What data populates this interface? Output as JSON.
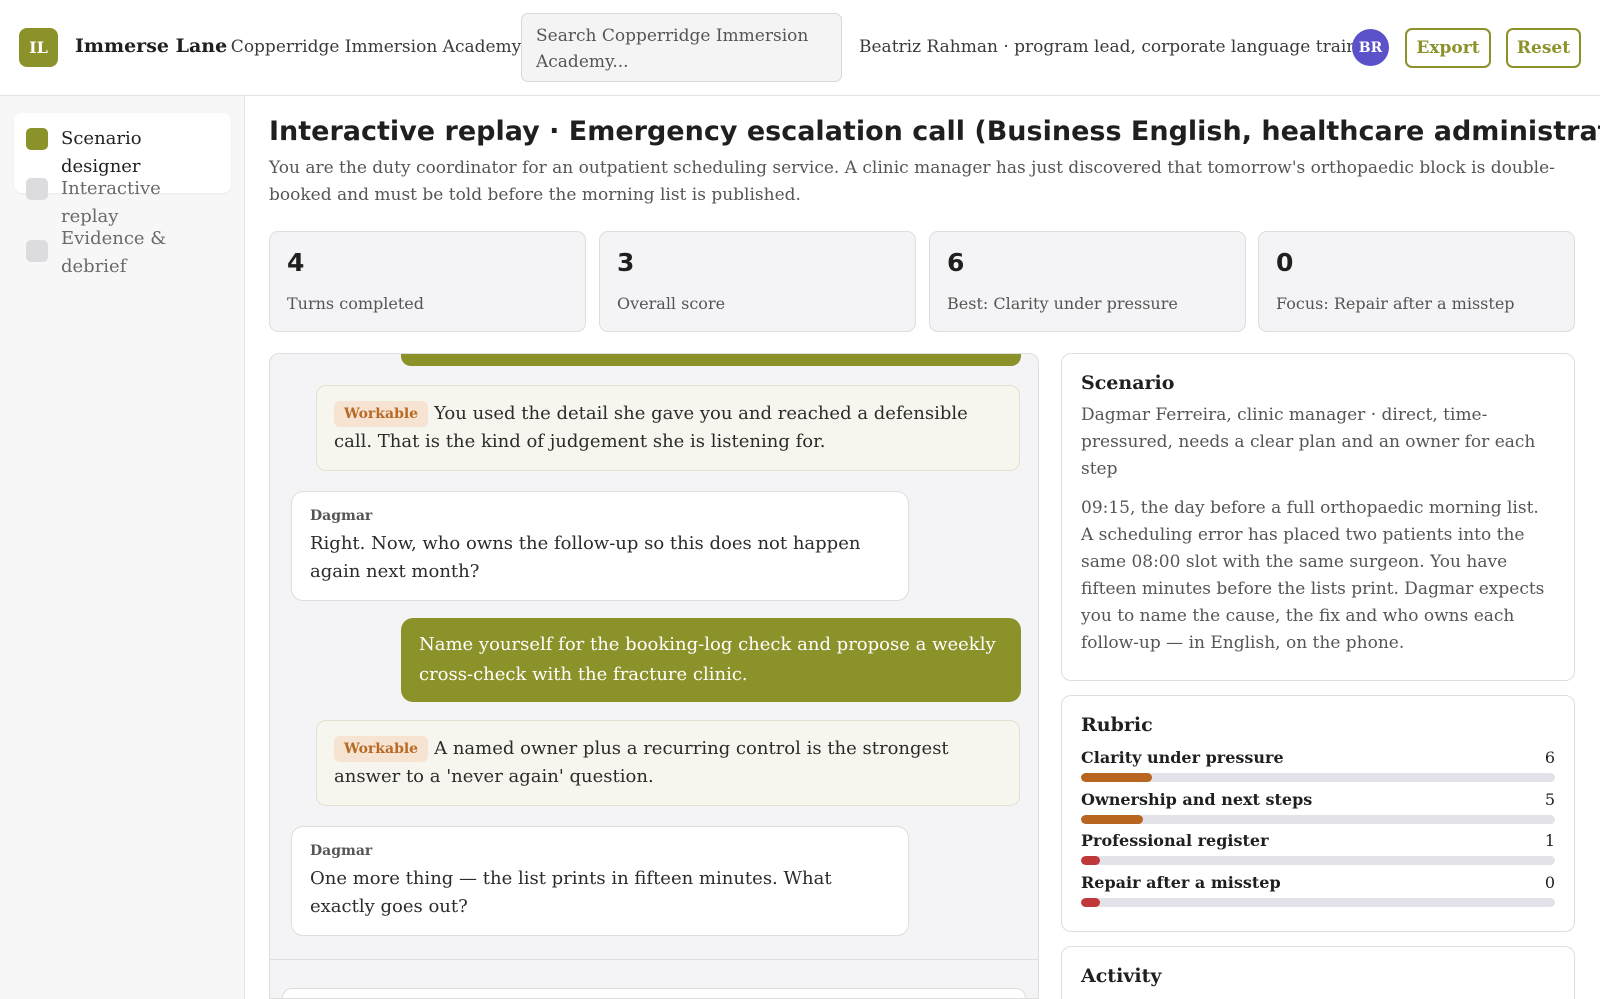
{
  "app": {
    "logo_initials": "IL",
    "name": "Immerse Lane",
    "org": "· Copperridge Immersion Academy",
    "search_placeholder": "Search Copperridge Immersion Academy...",
    "user": "Beatriz Rahman · program lead, corporate language training",
    "user_initials": "BR",
    "export_label": "Export",
    "reset_label": "Reset"
  },
  "sidebar": {
    "items": [
      {
        "label": "Scenario designer",
        "active": true
      },
      {
        "label": "Interactive replay",
        "active": false
      },
      {
        "label": "Evidence & debrief",
        "active": false
      }
    ]
  },
  "page": {
    "title": "Interactive replay · Emergency escalation call (Business English, healthcare administration)",
    "description": "You are the duty coordinator for an outpatient scheduling service. A clinic manager has just discovered that tomorrow's orthopaedic block is double-booked and must be told before the morning list is published."
  },
  "stats": [
    {
      "value": "4",
      "label": "Turns completed"
    },
    {
      "value": "3",
      "label": "Overall score"
    },
    {
      "value": "6",
      "label": "Best: Clarity under pressure"
    },
    {
      "value": "0",
      "label": "Focus: Repair after a misstep"
    }
  ],
  "transcript": [
    {
      "type": "feedback",
      "badge": "Workable",
      "text": "You used the detail she gave you and reached a defensible call. That is the kind of judgement she is listening for."
    },
    {
      "type": "message",
      "speaker": "Dagmar",
      "text": "Right. Now, who owns the follow-up so this does not happen again next month?"
    },
    {
      "type": "reply",
      "text": "Name yourself for the booking-log check and propose a weekly cross-check with the fracture clinic."
    },
    {
      "type": "feedback",
      "badge": "Workable",
      "text": "A named owner plus a recurring control is the strongest answer to a 'never again' question."
    },
    {
      "type": "message",
      "speaker": "Dagmar",
      "text": "One more thing — the list prints in fifteen minutes. What exactly goes out?"
    }
  ],
  "scenario": {
    "title": "Scenario",
    "persona": "Dagmar Ferreira, clinic manager · direct, time-pressured, needs a clear plan and an owner for each step",
    "text": "09:15, the day before a full orthopaedic morning list. A scheduling error has placed two patients into the same 08:00 slot with the same surgeon. You have fifteen minutes before the lists print. Dagmar expects you to name the cause, the fix and who owns each follow-up — in English, on the phone."
  },
  "rubric": {
    "title": "Rubric",
    "items": [
      {
        "label": "Clarity under pressure",
        "score": "6",
        "fill": 0.15,
        "color": "#b8651f"
      },
      {
        "label": "Ownership and next steps",
        "score": "5",
        "fill": 0.13,
        "color": "#b8651f"
      },
      {
        "label": "Professional register",
        "score": "1",
        "fill": 0.04,
        "color": "#c0383a"
      },
      {
        "label": "Repair after a misstep",
        "score": "0",
        "fill": 0.04,
        "color": "#c0383a"
      }
    ]
  },
  "activity": {
    "title": "Activity"
  },
  "colors": {
    "accent": "#8c922a",
    "avatar": "#5b52c9",
    "badge_text": "#b86a25"
  }
}
